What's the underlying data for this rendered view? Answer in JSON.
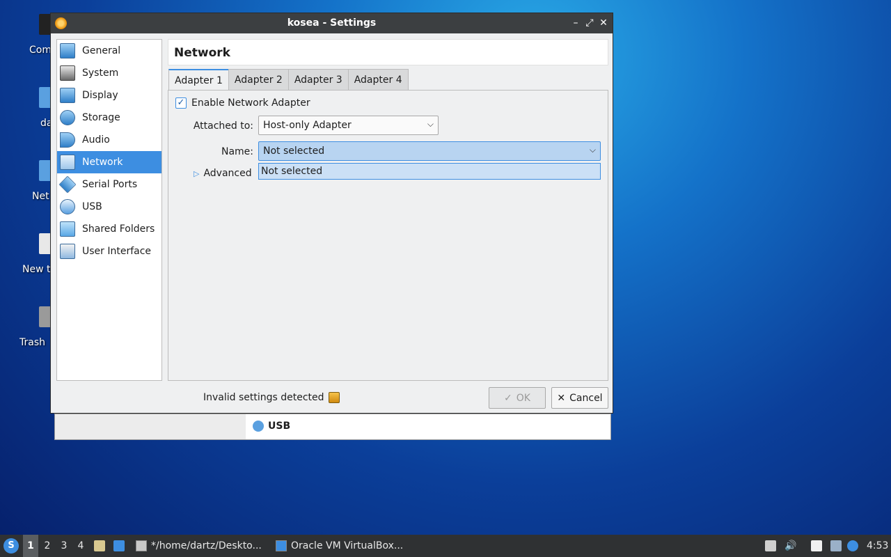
{
  "desktop": {
    "icons": [
      {
        "label": "Com"
      },
      {
        "label": "da"
      },
      {
        "label": "Net"
      },
      {
        "label": "New t"
      },
      {
        "label": "Trash"
      }
    ]
  },
  "background_window": {
    "section_label": "USB"
  },
  "dialog": {
    "title": "kosea - Settings",
    "titlebar_buttons": {
      "minimize": "–",
      "maximize": "⤢",
      "close": "✕"
    },
    "sidebar": {
      "items": [
        {
          "label": "General",
          "icon": "general-icon"
        },
        {
          "label": "System",
          "icon": "system-icon"
        },
        {
          "label": "Display",
          "icon": "display-icon"
        },
        {
          "label": "Storage",
          "icon": "storage-icon"
        },
        {
          "label": "Audio",
          "icon": "audio-icon"
        },
        {
          "label": "Network",
          "icon": "network-icon",
          "active": true
        },
        {
          "label": "Serial Ports",
          "icon": "serial-ports-icon"
        },
        {
          "label": "USB",
          "icon": "usb-icon"
        },
        {
          "label": "Shared Folders",
          "icon": "shared-folders-icon"
        },
        {
          "label": "User Interface",
          "icon": "user-interface-icon"
        }
      ]
    },
    "page_title": "Network",
    "tabs": [
      {
        "label": "Adapter 1",
        "active": true
      },
      {
        "label": "Adapter 2"
      },
      {
        "label": "Adapter 3"
      },
      {
        "label": "Adapter 4"
      }
    ],
    "adapter": {
      "enable_label": "Enable Network Adapter",
      "enabled": true,
      "attached_label": "Attached to:",
      "attached_value": "Host-only Adapter",
      "name_label": "Name:",
      "name_value": "Not selected",
      "name_options": [
        "Not selected"
      ],
      "advanced_label": "Advanced"
    },
    "status_text": "Invalid settings detected",
    "ok_label": "OK",
    "cancel_label": "Cancel"
  },
  "taskbar": {
    "workspaces": [
      "1",
      "2",
      "3",
      "4"
    ],
    "active_workspace": "1",
    "tasks": [
      {
        "label": "*/home/dartz/Deskto..."
      },
      {
        "label": "Oracle VM VirtualBox..."
      }
    ],
    "clock": "4:53"
  },
  "colors": {
    "accent": "#3d8ee1",
    "titlebar": "#3c3f41",
    "taskbar": "#2f3133"
  }
}
